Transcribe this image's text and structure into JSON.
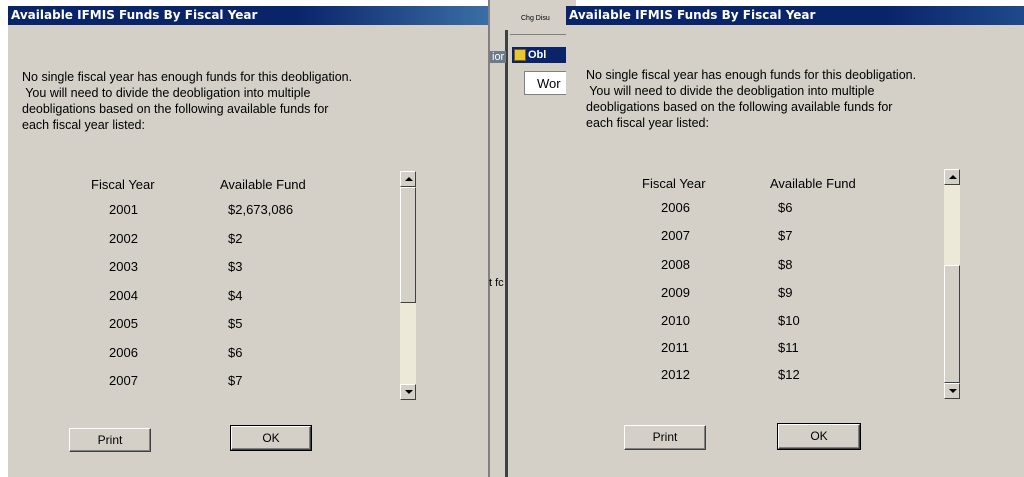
{
  "left_dialog": {
    "title": "Available IFMIS Funds By Fiscal Year",
    "message_lines": [
      "No single fiscal year has enough funds for this deobligation.",
      " You will need to divide the deobligation into multiple",
      "deobligations based on the following available funds for",
      "each fiscal year listed:"
    ],
    "col_fiscal_year": "Fiscal Year",
    "col_available_fund": "Available Fund",
    "rows": [
      {
        "year": "2001",
        "fund": "$2,673,086"
      },
      {
        "year": "2002",
        "fund": "$2"
      },
      {
        "year": "2003",
        "fund": "$3"
      },
      {
        "year": "2004",
        "fund": "$4"
      },
      {
        "year": "2005",
        "fund": "$5"
      },
      {
        "year": "2006",
        "fund": "$6"
      },
      {
        "year": "2007",
        "fund": "$7"
      }
    ],
    "print_label": "Print",
    "ok_label": "OK"
  },
  "right_dialog": {
    "title": "Available IFMIS Funds By Fiscal Year",
    "message_lines": [
      "No single fiscal year has enough funds for this deobligation.",
      " You will need to divide the deobligation into multiple",
      "deobligations based on the following available funds for",
      "each fiscal year listed:"
    ],
    "col_fiscal_year": "Fiscal Year",
    "col_available_fund": "Available Fund",
    "rows": [
      {
        "year": "2006",
        "fund": "$6"
      },
      {
        "year": "2007",
        "fund": "$7"
      },
      {
        "year": "2008",
        "fund": "$8"
      },
      {
        "year": "2009",
        "fund": "$9"
      },
      {
        "year": "2010",
        "fund": "$10"
      },
      {
        "year": "2011",
        "fund": "$11"
      },
      {
        "year": "2012",
        "fund": "$12"
      }
    ],
    "print_label": "Print",
    "ok_label": "OK"
  },
  "background": {
    "toolbar_button": "Chg Disu",
    "side_label_1": "ior",
    "side_label_2": "t fc",
    "window_title": "Obl",
    "tab_label": "Wor"
  }
}
